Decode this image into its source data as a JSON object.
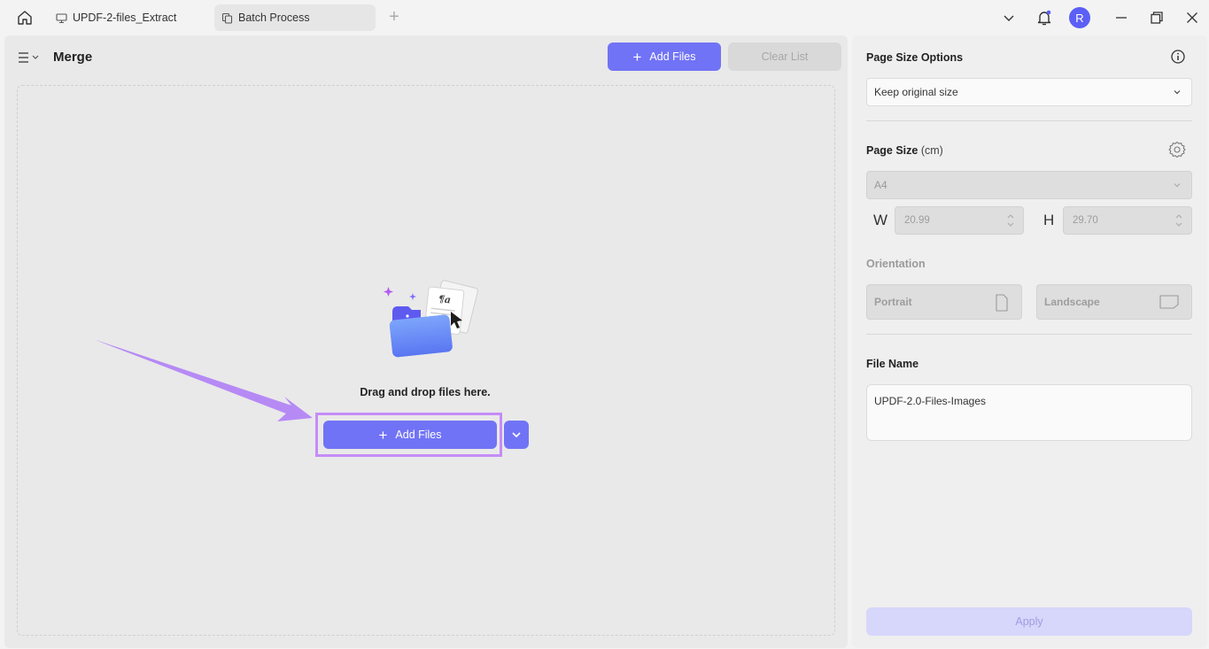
{
  "titlebar": {
    "tabs": [
      {
        "label": "UPDF-2-files_Extract",
        "icon": "monitor-icon"
      },
      {
        "label": "Batch Process",
        "icon": "batch-icon"
      }
    ],
    "avatar_initial": "R"
  },
  "left": {
    "title": "Merge",
    "add_files_label": "Add Files",
    "clear_list_label": "Clear List",
    "drop_text": "Drag and drop files here.",
    "main_add_label": "Add Files",
    "illustration_text": "¶a"
  },
  "right": {
    "page_size_options_title": "Page Size Options",
    "page_size_option_value": "Keep original size",
    "page_size_title": "Page Size",
    "page_size_unit": "(cm)",
    "paper_value": "A4",
    "width_label": "W",
    "height_label": "H",
    "width_value": "20.99",
    "height_value": "29.70",
    "orientation_title": "Orientation",
    "portrait_label": "Portrait",
    "landscape_label": "Landscape",
    "file_name_title": "File Name",
    "file_name_value": "UPDF-2.0-Files-Images",
    "apply_label": "Apply"
  },
  "colors": {
    "accent": "#7173f6",
    "highlight": "#c58cf7",
    "arrow": "#b68af5"
  }
}
